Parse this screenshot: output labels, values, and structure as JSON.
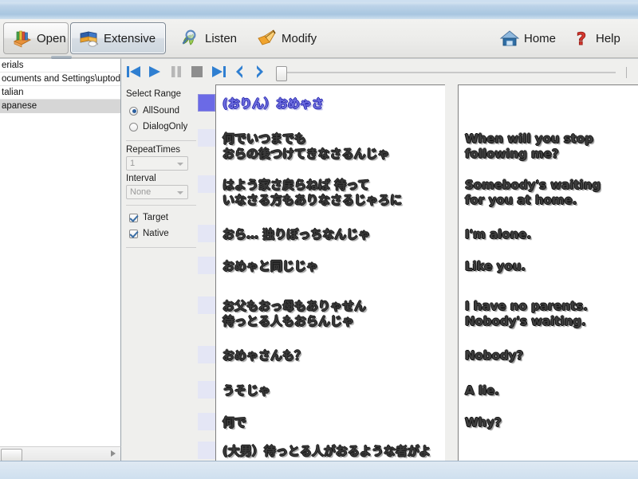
{
  "window": {
    "title": ""
  },
  "toolbar": {
    "buttons": [
      {
        "id": "open",
        "label": "Open",
        "icon": "books-stack-icon",
        "framed": true,
        "selected": false
      },
      {
        "id": "extensive",
        "label": "Extensive",
        "icon": "open-book-cup-icon",
        "framed": true,
        "selected": true
      },
      {
        "id": "listen",
        "label": "Listen",
        "icon": "magnifier-icon",
        "framed": false,
        "selected": false
      },
      {
        "id": "modify",
        "label": "Modify",
        "icon": "brush-icon",
        "framed": false,
        "selected": false
      }
    ],
    "right_buttons": [
      {
        "id": "home",
        "label": "Home",
        "icon": "home-icon"
      },
      {
        "id": "help",
        "label": "Help",
        "icon": "question-mark-icon"
      }
    ]
  },
  "tree": {
    "items": [
      {
        "label": "erials",
        "selected": false
      },
      {
        "label": "ocuments and Settings\\uptodown-",
        "selected": false
      },
      {
        "label": "talian",
        "selected": false
      },
      {
        "label": "apanese",
        "selected": true
      }
    ],
    "hscroll": {
      "arrow": "right-arrow-icon"
    }
  },
  "transport": {
    "buttons": [
      {
        "id": "prev-track",
        "icon": "skip-back-icon"
      },
      {
        "id": "play",
        "icon": "play-icon"
      },
      {
        "id": "pause",
        "icon": "pause-icon"
      },
      {
        "id": "stop",
        "icon": "stop-icon"
      },
      {
        "id": "next-track",
        "icon": "skip-forward-icon"
      },
      {
        "id": "step-back",
        "icon": "left-arrow-icon"
      },
      {
        "id": "step-fwd",
        "icon": "right-arrow-icon"
      }
    ],
    "slider": {
      "value": 0,
      "min": 0,
      "max": 100
    }
  },
  "options": {
    "select_range": {
      "title": "Select Range",
      "choices": [
        {
          "label": "AllSound",
          "checked": true
        },
        {
          "label": "DialogOnly",
          "checked": false
        }
      ]
    },
    "repeat_times": {
      "label": "RepeatTimes",
      "value": "1"
    },
    "interval": {
      "label": "Interval",
      "value": "None"
    },
    "toggles": [
      {
        "label": "Target",
        "checked": true
      },
      {
        "label": "Native",
        "checked": true
      }
    ]
  },
  "captions": {
    "japanese": [
      {
        "active": true,
        "speaker": true,
        "lines": [
          "(おりん）おめゃさ"
        ]
      },
      {
        "active": false,
        "speaker": false,
        "lines": [
          "何でいつまでも",
          "おらの後つけてきなさるんじゃ"
        ]
      },
      {
        "active": false,
        "speaker": false,
        "lines": [
          "はよう家さ戻らねば 待って",
          "いなさる方もありなさるじゃろに"
        ]
      },
      {
        "active": false,
        "speaker": false,
        "lines": [
          "おら… 独りぼっちなんじゃ"
        ]
      },
      {
        "active": false,
        "speaker": false,
        "lines": [
          "おめゃと同じじゃ"
        ]
      },
      {
        "active": false,
        "speaker": false,
        "lines": [
          "お父もおっ母もありゃせん",
          "待っとる人もおらんじゃ"
        ]
      },
      {
        "active": false,
        "speaker": false,
        "lines": [
          "おめゃさんも？"
        ]
      },
      {
        "active": false,
        "speaker": false,
        "lines": [
          "うそじゃ"
        ]
      },
      {
        "active": false,
        "speaker": false,
        "lines": [
          "何で"
        ]
      },
      {
        "active": false,
        "speaker": false,
        "lines": [
          "(大男）待っとる人がおるような者がよ"
        ]
      }
    ],
    "english": [
      {
        "lines": [
          "When will you stop",
          "following me?"
        ]
      },
      {
        "lines": [
          "Somebody's waiting",
          "for you at home."
        ]
      },
      {
        "lines": [
          "I'm alone."
        ]
      },
      {
        "lines": [
          "Like you."
        ]
      },
      {
        "lines": [
          "I have no parents.",
          "Nobody's waiting."
        ]
      },
      {
        "lines": [
          "Nobody?"
        ]
      },
      {
        "lines": [
          "A lie."
        ]
      },
      {
        "lines": [
          "Why?"
        ]
      }
    ]
  },
  "colors": {
    "active_marker": "#6b6ae6",
    "inactive_marker": "#e4e6f5",
    "speaker_text": "#6f6fe0",
    "titlebar": "#a8c6e0"
  }
}
